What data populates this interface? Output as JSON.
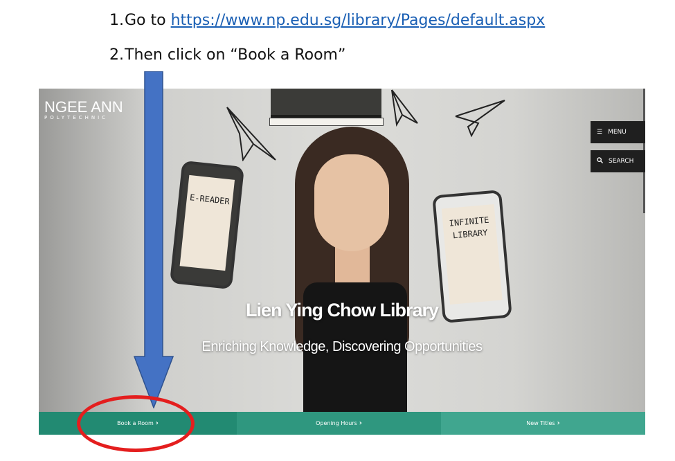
{
  "instructions": {
    "step1_num": "1.",
    "step1_text": "Go to ",
    "step1_link": "https://www.np.edu.sg/library/Pages/default.aspx",
    "step2_num": "2.",
    "step2_text": "Then click on “Book a Room”"
  },
  "site": {
    "logo_main": "NGEE ANN",
    "logo_sub": "POLYTECHNIC",
    "menu_label": "MENU",
    "search_label": "SEARCH",
    "hero_title": "Lien Ying Chow Library",
    "hero_subtitle": "Enriching Knowledge, Discovering Opportunities",
    "ereader_label": "E-READER",
    "library_label_1": "INFINITE",
    "library_label_2": "LIBRARY",
    "quicklinks": [
      {
        "label": "Book a Room"
      },
      {
        "label": "Opening Hours"
      },
      {
        "label": "New Titles"
      }
    ]
  },
  "colors": {
    "link": "#1a5fb4",
    "arrow": "#4472c4",
    "highlight_circle": "#e41e1e",
    "quicklink_1": "#228a72",
    "quicklink_2": "#2f977f",
    "quicklink_3": "#40a68f"
  },
  "icons": {
    "menu": "hamburger-icon",
    "search": "magnifier-icon",
    "chevron": "chevron-right-icon"
  }
}
